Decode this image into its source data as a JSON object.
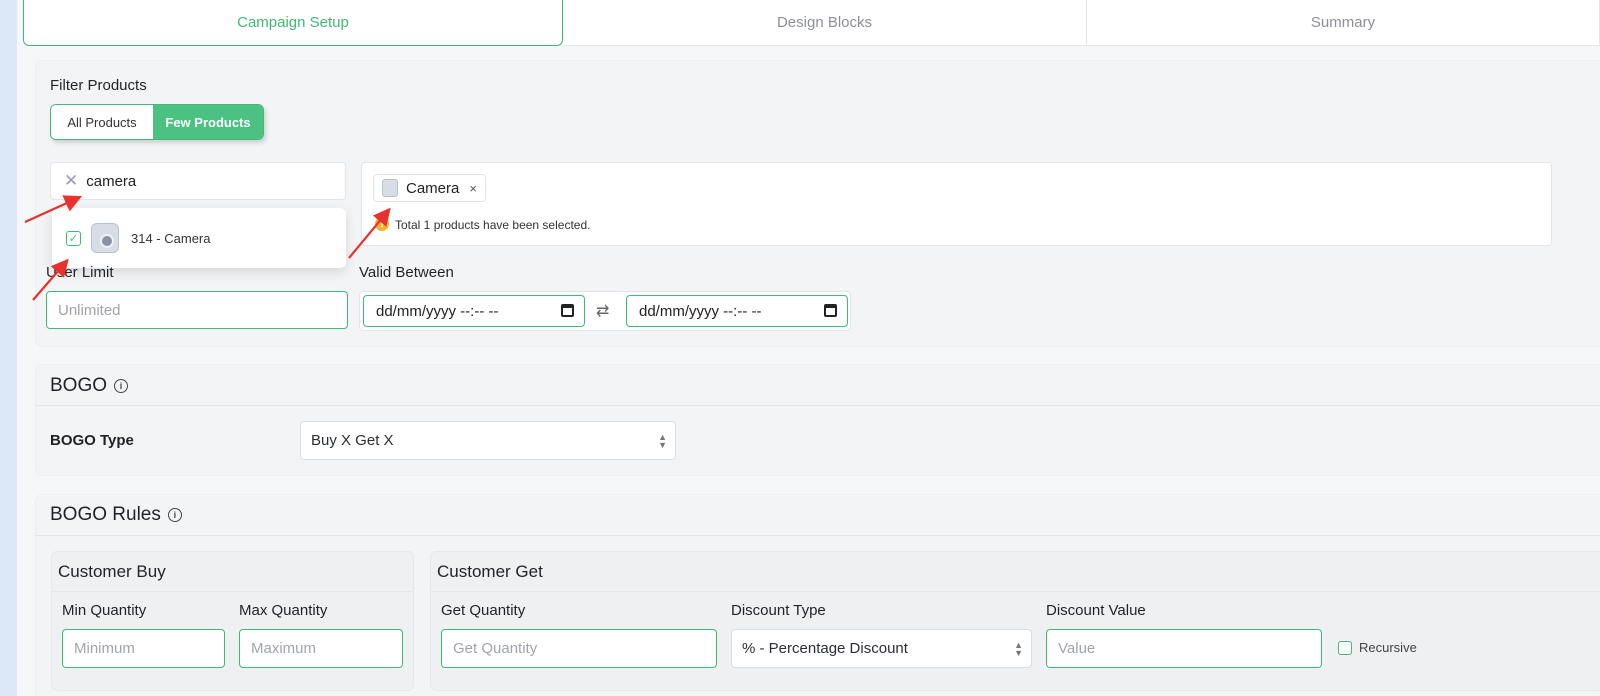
{
  "tabs": [
    "Campaign Setup",
    "Design Blocks",
    "Summary"
  ],
  "filter": {
    "label": "Filter Products",
    "options": [
      "All Products",
      "Few Products"
    ],
    "selected": "Few Products"
  },
  "search": {
    "query": "camera"
  },
  "dropdown_item": {
    "text": "314 - Camera",
    "checked": true
  },
  "selected_chip": {
    "label": "Camera",
    "remove_symbol": "×"
  },
  "selection_note": "Total 1 products have been selected.",
  "user_limit": {
    "label": "User Limit",
    "placeholder": "Unlimited"
  },
  "valid_between": {
    "label": "Valid Between",
    "from_display": "dd/mm/yyyy --:-- --",
    "to_display": "dd/mm/yyyy --:-- --"
  },
  "bogo": {
    "heading": "BOGO",
    "type_label": "BOGO Type",
    "type_value": "Buy X Get X"
  },
  "bogo_rules": {
    "heading": "BOGO Rules",
    "customer_buy": {
      "title": "Customer Buy",
      "min_label": "Min Quantity",
      "min_placeholder": "Minimum",
      "max_label": "Max Quantity",
      "max_placeholder": "Maximum"
    },
    "customer_get": {
      "title": "Customer Get",
      "qty_label": "Get Quantity",
      "qty_placeholder": "Get Quantity",
      "discount_type_label": "Discount Type",
      "discount_type_value": "% - Percentage Discount",
      "discount_value_label": "Discount Value",
      "discount_value_placeholder": "Value",
      "recursive_label": "Recursive"
    }
  },
  "colors": {
    "accent": "#3fb977",
    "annotation": "#e8312c"
  }
}
